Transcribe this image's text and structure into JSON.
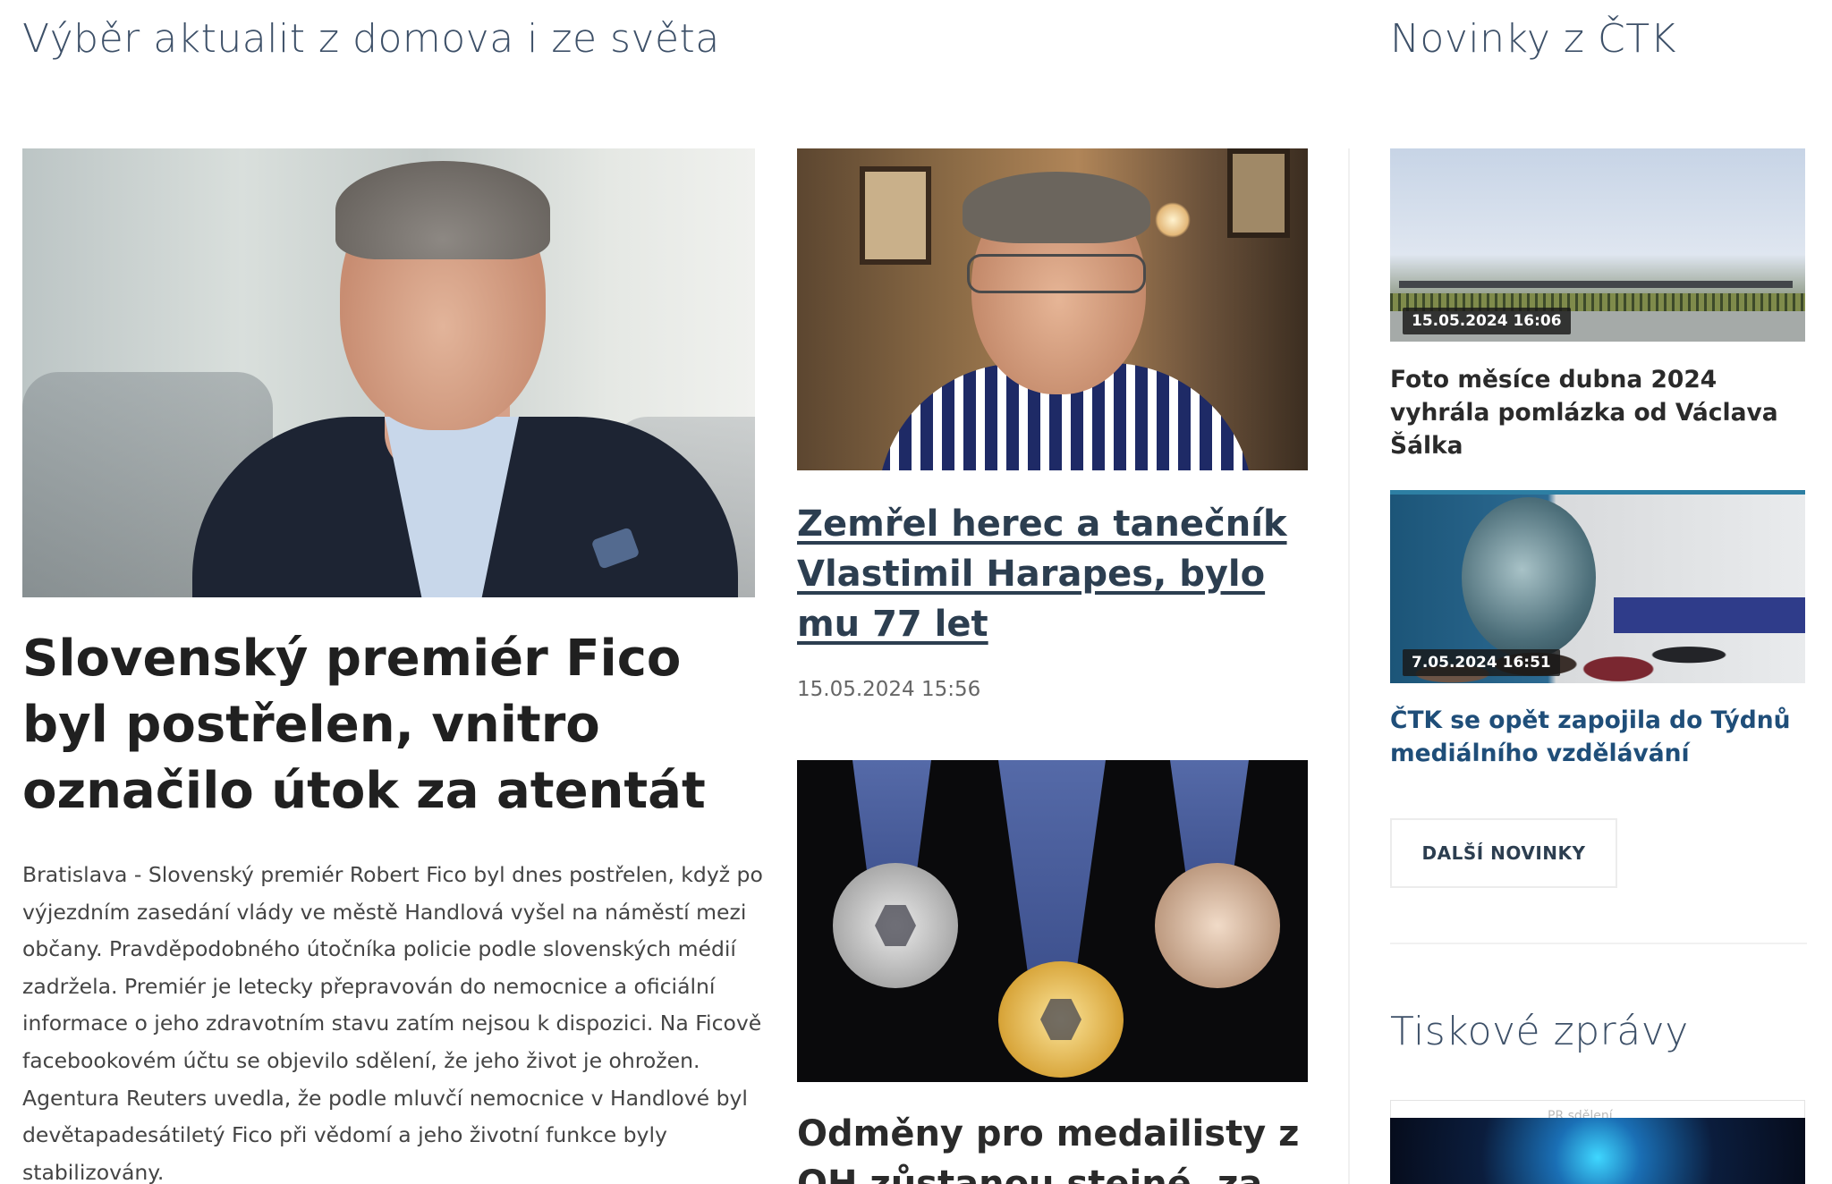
{
  "sections": {
    "main_title": "Výběr aktualit z domova i ze světa",
    "ctk_title": "Novinky z ČTK",
    "press_title": "Tiskové zprávy"
  },
  "lead_article": {
    "headline": "Slovenský premiér Fico byl postřelen, vnitro označilo útok za atentát",
    "text": "Bratislava - Slovenský premiér Robert Fico byl dnes postřelen, když po výjezdním zasedání vlády ve městě Handlová vyšel na náměstí mezi občany. Pravděpodobného útočníka policie podle slovenských médií zadržela. Premiér je letecky přepravován do nemocnice a oficiální informace o jeho zdravotním stavu zatím nejsou k dispozici. Na Ficově facebookovém účtu se objevilo sdělení, že jeho život je ohrožen. Agentura Reuters uvedla, že podle mluvčí nemocnice v Handlové byl devětapadesátiletý Fico při vědomí a jeho životní funkce byly stabilizovány."
  },
  "side_articles": [
    {
      "headline": "Zemřel herec a tanečník Vlastimil Harapes, bylo mu 77 let",
      "date": "15.05.2024 15:56"
    },
    {
      "headline": "Odměny pro medailisty z OH zůstanou stejné, za"
    }
  ],
  "ctk_news": [
    {
      "date": "15.05.2024 16:06",
      "headline": "Foto měsíce dubna 2024 vyhrála pomlázka od Václava Šálka"
    },
    {
      "date": "7.05.2024 16:51",
      "headline": "ČTK se opět zapojila do Týdnů mediálního vzdělávání"
    }
  ],
  "more_button": "DALŠÍ NOVINKY",
  "press": {
    "tag": "PR sdělení"
  }
}
